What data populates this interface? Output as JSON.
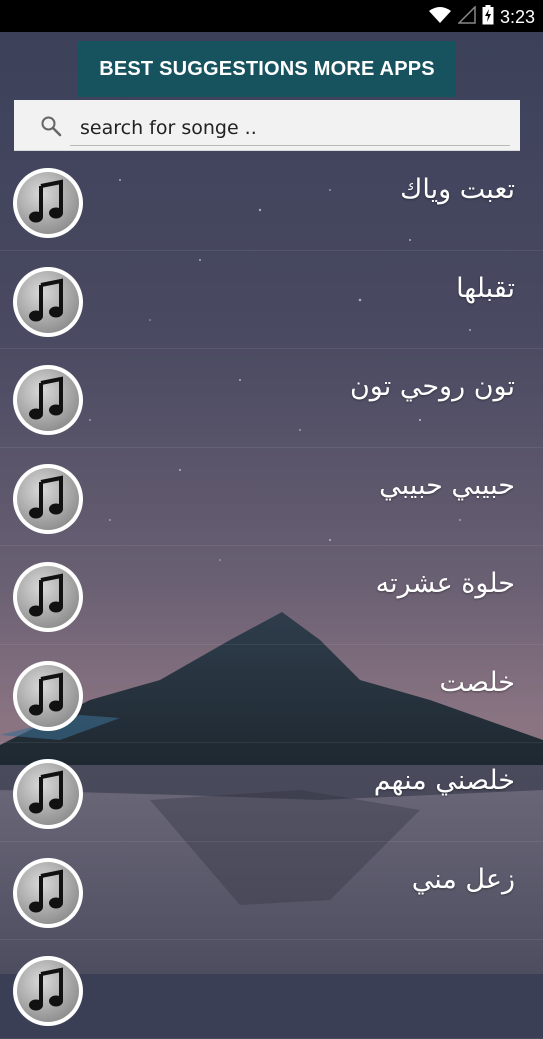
{
  "status_bar": {
    "time": "3:23",
    "icons": [
      "wifi-icon",
      "signal-icon",
      "battery-charging-icon"
    ]
  },
  "promo": {
    "label": "BEST SUGGESTIONS MORE APPS"
  },
  "search": {
    "icon": "search-icon",
    "placeholder": "search for songe .."
  },
  "songs": {
    "icon": "music-note-icon",
    "items": [
      {
        "title": "تعبت وياك"
      },
      {
        "title": "تقبلها"
      },
      {
        "title": "تون روحي تون"
      },
      {
        "title": "حبيبي حبيبي"
      },
      {
        "title": "حلوة عشرته"
      },
      {
        "title": "خلصت"
      },
      {
        "title": "خلصني منهم"
      },
      {
        "title": "زعل مني"
      }
    ]
  },
  "colors": {
    "promo_bg": "#17525f",
    "status_bar_bg": "#000000",
    "search_bg": "#f2f2f2"
  }
}
